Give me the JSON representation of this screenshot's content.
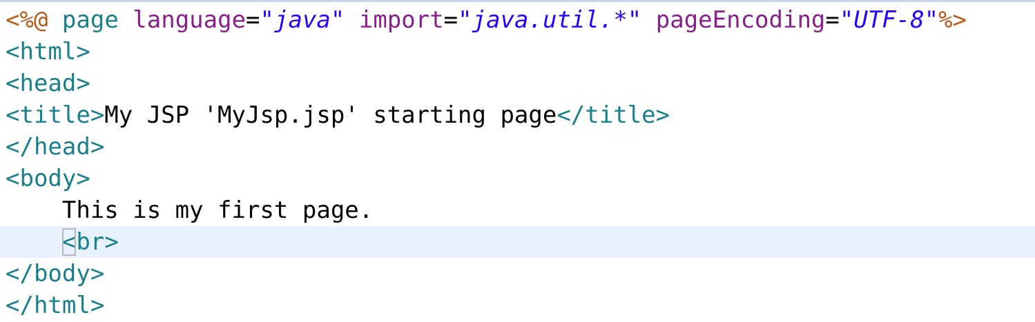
{
  "editor": {
    "lines": [
      {
        "tokens": [
          {
            "text": "<%@",
            "kind": "jsp-delim"
          },
          {
            "text": " ",
            "kind": "text"
          },
          {
            "text": "page",
            "kind": "jsp-name"
          },
          {
            "text": " ",
            "kind": "text"
          },
          {
            "text": "language",
            "kind": "attr"
          },
          {
            "text": "=",
            "kind": "eq"
          },
          {
            "text": "\"java\"",
            "kind": "val"
          },
          {
            "text": " ",
            "kind": "text"
          },
          {
            "text": "import",
            "kind": "attr"
          },
          {
            "text": "=",
            "kind": "eq"
          },
          {
            "text": "\"java.util.*\"",
            "kind": "val"
          },
          {
            "text": " ",
            "kind": "text"
          },
          {
            "text": "pageEncoding",
            "kind": "attr"
          },
          {
            "text": "=",
            "kind": "eq"
          },
          {
            "text": "\"UTF-8\"",
            "kind": "val"
          },
          {
            "text": "%>",
            "kind": "jsp-delim"
          }
        ]
      },
      {
        "tokens": [
          {
            "text": "<html>",
            "kind": "tag"
          }
        ]
      },
      {
        "tokens": [
          {
            "text": "<head>",
            "kind": "tag"
          }
        ]
      },
      {
        "tokens": [
          {
            "text": "<title>",
            "kind": "tag"
          },
          {
            "text": "My JSP 'MyJsp.jsp' starting page",
            "kind": "text"
          },
          {
            "text": "</title>",
            "kind": "tag"
          }
        ]
      },
      {
        "tokens": [
          {
            "text": "</head>",
            "kind": "tag"
          }
        ]
      },
      {
        "tokens": [
          {
            "text": "<body>",
            "kind": "tag"
          }
        ]
      },
      {
        "tokens": [
          {
            "text": "    ",
            "kind": "text"
          },
          {
            "text": "This is my first page.",
            "kind": "text"
          }
        ]
      },
      {
        "current": true,
        "tokens": [
          {
            "text": "    ",
            "kind": "text"
          },
          {
            "text": "<",
            "kind": "tag",
            "match": true
          },
          {
            "text": "br>",
            "kind": "tag"
          }
        ]
      },
      {
        "tokens": [
          {
            "text": "</body>",
            "kind": "tag"
          }
        ]
      },
      {
        "tokens": [
          {
            "text": "</html>",
            "kind": "tag"
          }
        ]
      }
    ]
  },
  "colors": {
    "tag": "#17808a",
    "jsp_delimiter": "#b85a1a",
    "attribute": "#8a1e8a",
    "value": "#2a00ff",
    "text": "#000000",
    "current_line_bg": "#e8f2fe"
  }
}
